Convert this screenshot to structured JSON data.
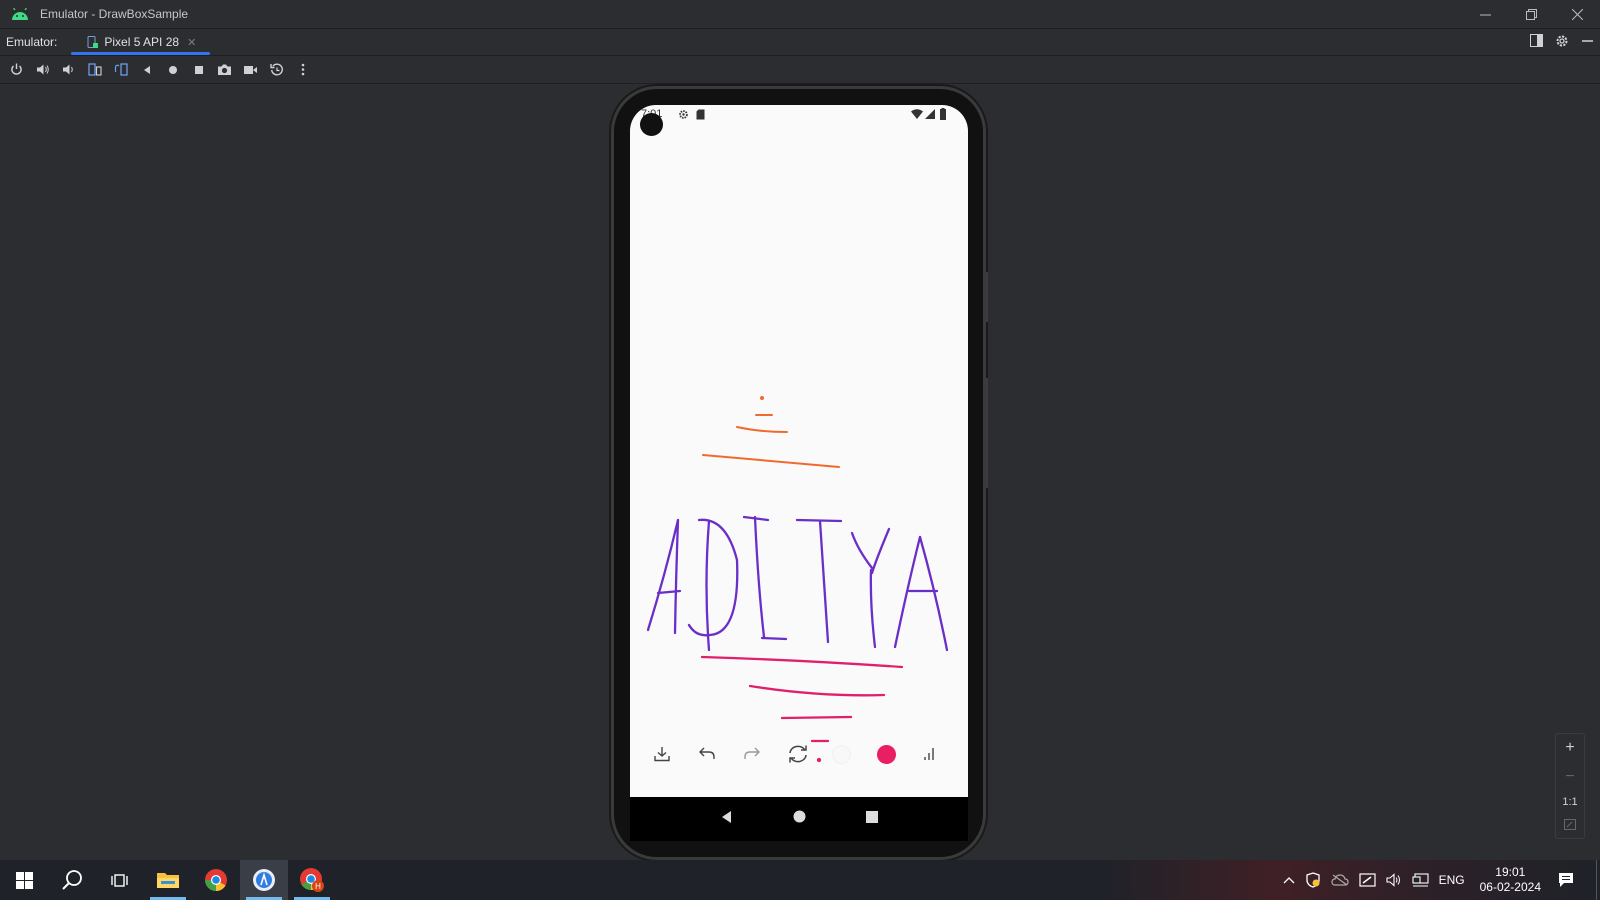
{
  "window": {
    "title": "Emulator - DrawBoxSample"
  },
  "tabbar": {
    "label": "Emulator:",
    "tab_label": "Pixel 5 API 28"
  },
  "phone": {
    "status_time": "7:01",
    "drawing": {
      "text_strokes": "ADITYA",
      "colors": {
        "orange": "#f06a2e",
        "purple": "#6a2fc8",
        "pink": "#e0206a"
      }
    },
    "bottom_bar": {
      "selected_color": "#e91e63"
    }
  },
  "zoom": {
    "one_to_one": "1:1"
  },
  "taskbar": {
    "language": "ENG",
    "time": "19:01",
    "date": "06-02-2024"
  }
}
